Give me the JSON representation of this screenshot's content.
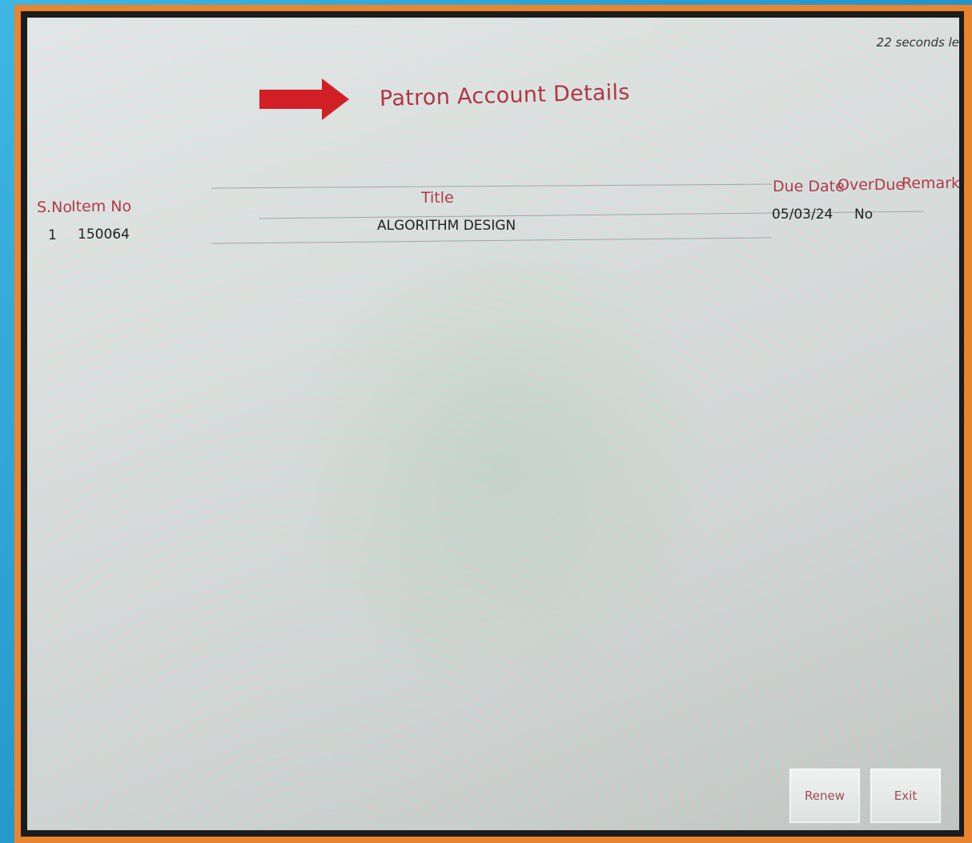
{
  "timer_text": "22 seconds le",
  "page_title": "Patron Account Details",
  "colors": {
    "heading": "#b03545",
    "arrow": "#d21f26",
    "frame": "#e9842f",
    "background": "#1f8fc8"
  },
  "table": {
    "columns": {
      "sno": "S.No",
      "item_no": "Item No",
      "title": "Title",
      "due_date": "Due Date",
      "overdue": "OverDue",
      "remarks": "Remarks"
    },
    "rows": [
      {
        "sno": "1",
        "item_no": "150064",
        "title": "ALGORITHM DESIGN",
        "due_date": "05/03/24",
        "overdue": "No",
        "remarks": ""
      }
    ]
  },
  "buttons": {
    "renew": "Renew",
    "exit": "Exit"
  }
}
